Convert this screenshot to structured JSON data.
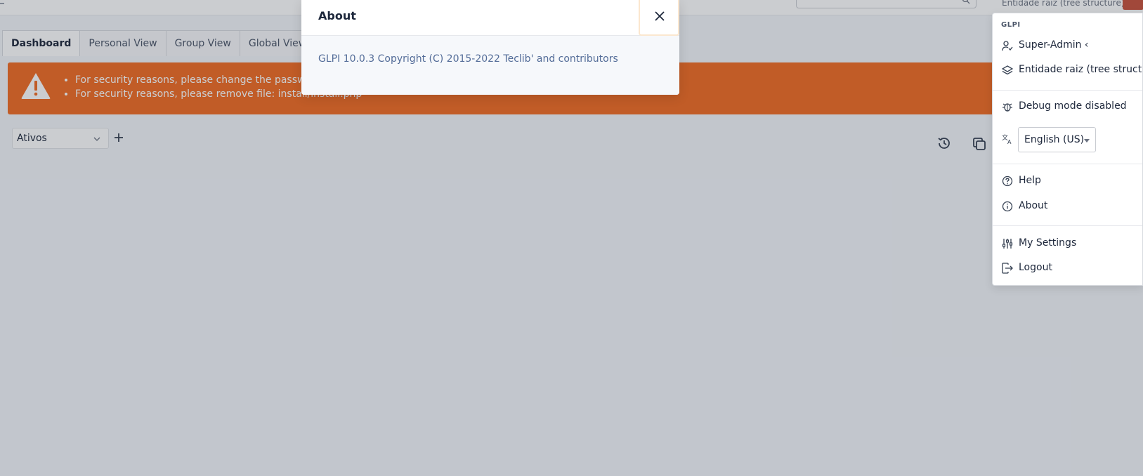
{
  "header": {
    "entity_label": "Entidade raiz (tree structure)"
  },
  "tabs": [
    {
      "label": "Dashboard",
      "active": true
    },
    {
      "label": "Personal View",
      "active": false
    },
    {
      "label": "Group View",
      "active": false
    },
    {
      "label": "Global View",
      "active": false
    }
  ],
  "alert": {
    "messages": [
      "For security reasons, please change the password",
      "For security reasons, please remove file: install/install.php"
    ],
    "color": "#f26b21"
  },
  "dashboard": {
    "selected": "Ativos"
  },
  "modal": {
    "title": "About",
    "body": "GLPI 10.0.3 Copyright (C) 2015-2022 Teclib' and contributors"
  },
  "menu": {
    "header": "GLPI",
    "profile": "Super-Admin",
    "entity": "Entidade raiz (tree structure)",
    "debug": "Debug mode disabled",
    "language": "English (US)",
    "help": "Help",
    "about": "About",
    "settings": "My Settings",
    "logout": "Logout"
  },
  "colors": {
    "accent": "#f26b21",
    "link": "#536c98"
  }
}
